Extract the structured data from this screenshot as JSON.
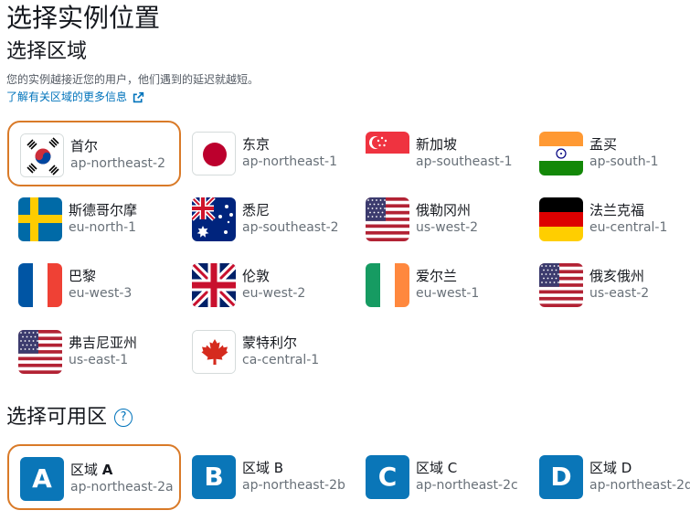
{
  "page": {
    "title": "选择实例位置",
    "region_heading": "选择区域",
    "description": "您的实例越接近您的用户，他们遇到的延迟就越短。",
    "learn_more": "了解有关区域的更多信息",
    "az_heading": "选择可用区",
    "help_glyph": "?"
  },
  "regions": [
    {
      "name": "首尔",
      "code": "ap-northeast-2",
      "flag": "south-korea-flag-icon",
      "selected": true
    },
    {
      "name": "东京",
      "code": "ap-northeast-1",
      "flag": "japan-flag-icon",
      "selected": false
    },
    {
      "name": "新加坡",
      "code": "ap-southeast-1",
      "flag": "singapore-flag-icon",
      "selected": false
    },
    {
      "name": "孟买",
      "code": "ap-south-1",
      "flag": "india-flag-icon",
      "selected": false
    },
    {
      "name": "斯德哥尔摩",
      "code": "eu-north-1",
      "flag": "sweden-flag-icon",
      "selected": false
    },
    {
      "name": "悉尼",
      "code": "ap-southeast-2",
      "flag": "australia-flag-icon",
      "selected": false
    },
    {
      "name": "俄勒冈州",
      "code": "us-west-2",
      "flag": "usa-flag-icon",
      "selected": false
    },
    {
      "name": "法兰克福",
      "code": "eu-central-1",
      "flag": "germany-flag-icon",
      "selected": false
    },
    {
      "name": "巴黎",
      "code": "eu-west-3",
      "flag": "france-flag-icon",
      "selected": false
    },
    {
      "name": "伦敦",
      "code": "eu-west-2",
      "flag": "uk-flag-icon",
      "selected": false
    },
    {
      "name": "爱尔兰",
      "code": "eu-west-1",
      "flag": "ireland-flag-icon",
      "selected": false
    },
    {
      "name": "俄亥俄州",
      "code": "us-east-2",
      "flag": "usa-flag-icon",
      "selected": false
    },
    {
      "name": "弗吉尼亚州",
      "code": "us-east-1",
      "flag": "usa-flag-icon",
      "selected": false
    },
    {
      "name": "蒙特利尔",
      "code": "ca-central-1",
      "flag": "canada-flag-icon",
      "selected": false
    }
  ],
  "zones": [
    {
      "letter": "A",
      "prefix": "区域",
      "suffix": "A",
      "code": "ap-northeast-2a",
      "selected": true
    },
    {
      "letter": "B",
      "prefix": "区域",
      "suffix": "B",
      "code": "ap-northeast-2b",
      "selected": false
    },
    {
      "letter": "C",
      "prefix": "区域",
      "suffix": "C",
      "code": "ap-northeast-2c",
      "selected": false
    },
    {
      "letter": "D",
      "prefix": "区域",
      "suffix": "D",
      "code": "ap-northeast-2d",
      "selected": false
    }
  ],
  "colors": {
    "accent_link": "#0073bb",
    "selected_border": "#d97a28",
    "az_tile": "#0a76b8"
  }
}
